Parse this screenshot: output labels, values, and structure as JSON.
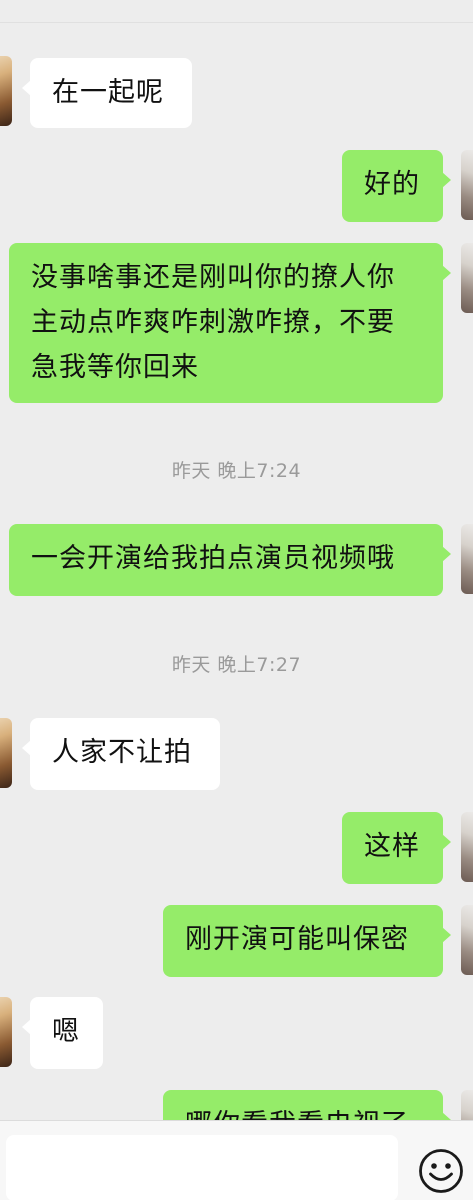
{
  "messages": [
    {
      "side": "in",
      "text": "在一起呢"
    },
    {
      "side": "out",
      "text": "好的"
    },
    {
      "side": "out",
      "text": "没事啥事还是刚叫你的撩人你主动点咋爽咋刺激咋撩，不要急我等你回来"
    },
    {
      "side": "out",
      "text": "一会开演给我拍点演员视频哦"
    },
    {
      "side": "in",
      "text": "人家不让拍"
    },
    {
      "side": "out",
      "text": "这样"
    },
    {
      "side": "out",
      "text": "刚开演可能叫保密"
    },
    {
      "side": "in",
      "text": "嗯"
    },
    {
      "side": "out",
      "text": "哪你看我看电视了"
    }
  ],
  "timestamps": [
    "昨天 晚上7:24",
    "昨天 晚上7:27"
  ],
  "input": {
    "value": "",
    "placeholder": ""
  },
  "icons": {
    "emoji": "smiley-face-icon"
  },
  "colors": {
    "outgoing": "#95ec69",
    "incoming": "#ffffff",
    "background": "#ededed"
  }
}
